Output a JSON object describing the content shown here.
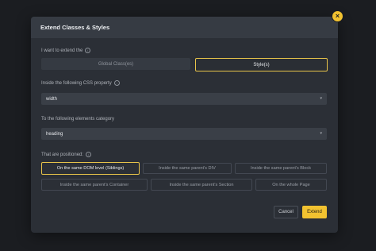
{
  "dialog": {
    "title": "Extend Classes & Styles",
    "close_label": "×"
  },
  "extend_section": {
    "label": "I want to extend the",
    "options": [
      "Global Class(es)",
      "Style(s)"
    ],
    "selected": "Style(s)"
  },
  "css_property": {
    "label": "Inside the following CSS property",
    "value": "width"
  },
  "category": {
    "label": "To the following elements category",
    "value": "heading"
  },
  "positioned": {
    "label": "That are positioned:",
    "options": [
      "On the same DOM level (Siblings)",
      "Inside the same parent's DIV",
      "Inside the same parent's Block",
      "Inside the same parent's Container",
      "Inside the same parent's Section",
      "On the whole Page"
    ],
    "selected": "On the same DOM level (Siblings)"
  },
  "actions": {
    "cancel": "Cancel",
    "extend": "Extend"
  },
  "colors": {
    "accent": "#f2c230",
    "modal_bg": "#2b2f36",
    "header_bg": "#363b43"
  },
  "icons": {
    "info": "info-icon",
    "close": "close-icon",
    "chevron": "chevron-down-icon"
  }
}
